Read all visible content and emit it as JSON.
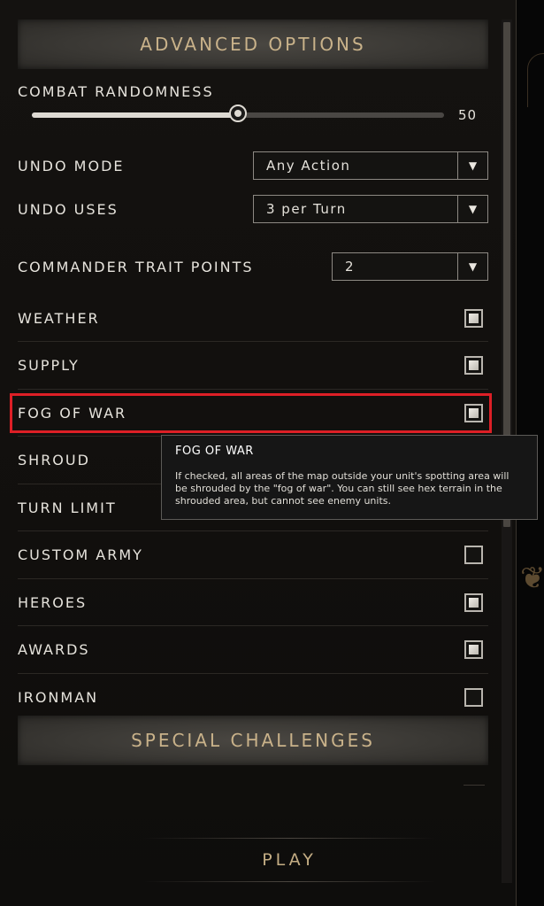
{
  "advanced_options": {
    "title": "ADVANCED OPTIONS"
  },
  "combat_randomness": {
    "label": "COMBAT RANDOMNESS",
    "value": "50",
    "fraction": 0.5
  },
  "undo_mode": {
    "label": "UNDO MODE",
    "selected": "Any Action",
    "icon": "chevron-down-icon"
  },
  "undo_uses": {
    "label": "UNDO USES",
    "selected": "3 per Turn",
    "icon": "chevron-down-icon"
  },
  "commander_trait_points": {
    "label": "COMMANDER TRAIT POINTS",
    "selected": "2",
    "icon": "chevron-down-icon"
  },
  "toggles": [
    {
      "label": "WEATHER",
      "checked": true
    },
    {
      "label": "SUPPLY",
      "checked": true
    },
    {
      "label": "FOG OF WAR",
      "checked": true
    },
    {
      "label": "SHROUD",
      "checked": false
    },
    {
      "label": "TURN LIMIT",
      "checked": false
    },
    {
      "label": "CUSTOM ARMY",
      "checked": false
    },
    {
      "label": "HEROES",
      "checked": true
    },
    {
      "label": "AWARDS",
      "checked": true
    },
    {
      "label": "IRONMAN",
      "checked": false
    }
  ],
  "tooltip": {
    "title": "FOG OF WAR",
    "body": "If checked, all areas of the  map outside your unit's spotting area will be shrouded by the \"fog of war\". You can still see hex terrain in the shrouded area, but cannot see enemy units."
  },
  "special_challenges": {
    "title": "SPECIAL CHALLENGES"
  },
  "play_button": {
    "label": "PLAY"
  },
  "colors": {
    "highlight": "#dd1f26",
    "header_text": "#c9b28a",
    "play_text": "#c4ad84"
  }
}
